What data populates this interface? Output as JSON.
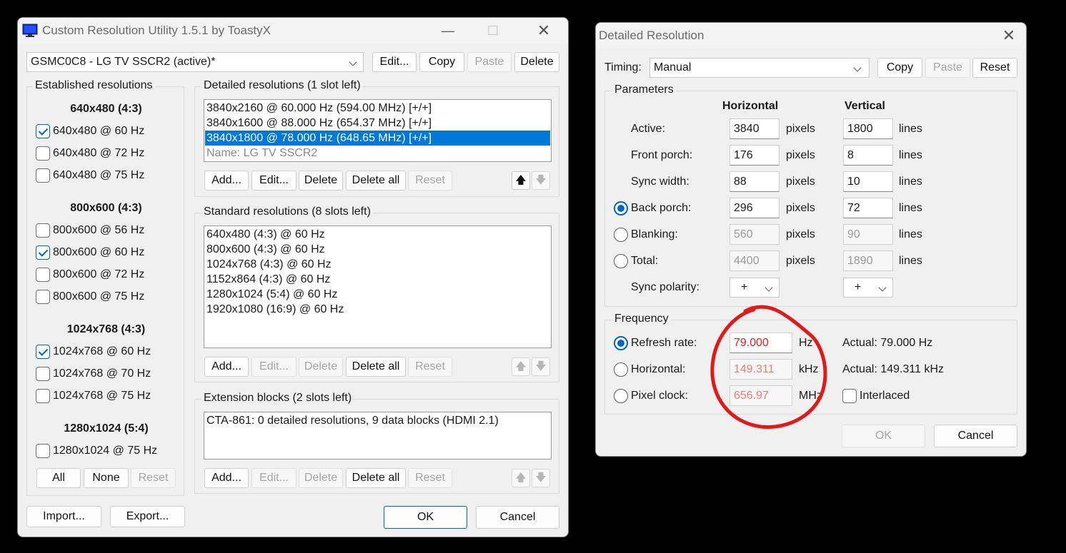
{
  "main": {
    "title": "Custom Resolution Utility 1.5.1 by ToastyX",
    "monitor_select": "GSMC0C8 - LG TV SSCR2 (active)*",
    "top_buttons": {
      "edit": "Edit...",
      "copy": "Copy",
      "paste": "Paste",
      "delete": "Delete"
    },
    "established": {
      "label": "Established resolutions",
      "groups": [
        {
          "header": "640x480 (4:3)",
          "items": [
            {
              "label": "640x480 @ 60 Hz",
              "checked": true
            },
            {
              "label": "640x480 @ 72 Hz",
              "checked": false
            },
            {
              "label": "640x480 @ 75 Hz",
              "checked": false
            }
          ]
        },
        {
          "header": "800x600 (4:3)",
          "items": [
            {
              "label": "800x600 @ 56 Hz",
              "checked": false
            },
            {
              "label": "800x600 @ 60 Hz",
              "checked": true
            },
            {
              "label": "800x600 @ 72 Hz",
              "checked": false
            },
            {
              "label": "800x600 @ 75 Hz",
              "checked": false
            }
          ]
        },
        {
          "header": "1024x768 (4:3)",
          "items": [
            {
              "label": "1024x768 @ 60 Hz",
              "checked": true
            },
            {
              "label": "1024x768 @ 70 Hz",
              "checked": false
            },
            {
              "label": "1024x768 @ 75 Hz",
              "checked": false
            }
          ]
        },
        {
          "header": "1280x1024 (5:4)",
          "items": [
            {
              "label": "1280x1024 @ 75 Hz",
              "checked": false
            }
          ]
        }
      ],
      "buttons": {
        "all": "All",
        "none": "None",
        "reset": "Reset"
      }
    },
    "detailed": {
      "label": "Detailed resolutions (1 slot left)",
      "items": [
        "3840x2160 @ 60.000 Hz (594.00 MHz) [+/+]",
        "3840x1600 @ 88.000 Hz (654.37 MHz) [+/+]",
        "3840x1800 @ 78.000 Hz (648.65 MHz) [+/+]"
      ],
      "name_line": "Name: LG TV SSCR2",
      "buttons": {
        "add": "Add...",
        "edit": "Edit...",
        "delete": "Delete",
        "delete_all": "Delete all",
        "reset": "Reset"
      }
    },
    "standard": {
      "label": "Standard resolutions (8 slots left)",
      "items": [
        "640x480 (4:3) @ 60 Hz",
        "800x600 (4:3) @ 60 Hz",
        "1024x768 (4:3) @ 60 Hz",
        "1152x864 (4:3) @ 60 Hz",
        "1280x1024 (5:4) @ 60 Hz",
        "1920x1080 (16:9) @ 60 Hz"
      ],
      "buttons": {
        "add": "Add...",
        "edit": "Edit...",
        "delete": "Delete",
        "delete_all": "Delete all",
        "reset": "Reset"
      }
    },
    "extension": {
      "label": "Extension blocks (2 slots left)",
      "items": [
        "CTA-861: 0 detailed resolutions, 9 data blocks (HDMI 2.1)"
      ],
      "buttons": {
        "add": "Add...",
        "edit": "Edit...",
        "delete": "Delete",
        "delete_all": "Delete all",
        "reset": "Reset"
      }
    },
    "bottom": {
      "import": "Import...",
      "export": "Export...",
      "ok": "OK",
      "cancel": "Cancel"
    }
  },
  "detail": {
    "title": "Detailed Resolution",
    "timing_label": "Timing:",
    "timing_value": "Manual",
    "buttons": {
      "copy": "Copy",
      "paste": "Paste",
      "reset": "Reset"
    },
    "params": {
      "label": "Parameters",
      "col_h": "Horizontal",
      "col_v": "Vertical",
      "unit_h": "pixels",
      "unit_v": "lines",
      "rows": [
        {
          "label": "Active:",
          "h": "3840",
          "v": "1800"
        },
        {
          "label": "Front porch:",
          "h": "176",
          "v": "8"
        },
        {
          "label": "Sync width:",
          "h": "88",
          "v": "10"
        },
        {
          "label": "Back porch:",
          "h": "296",
          "v": "72"
        },
        {
          "label": "Blanking:",
          "h": "560",
          "v": "90"
        },
        {
          "label": "Total:",
          "h": "4400",
          "v": "1890"
        }
      ],
      "polarity_label": "Sync polarity:",
      "polarity_h": "+",
      "polarity_v": "+"
    },
    "freq": {
      "label": "Frequency",
      "rows": [
        {
          "label": "Refresh rate:",
          "value": "79.000",
          "unit": "Hz",
          "actual": "Actual: 79.000 Hz"
        },
        {
          "label": "Horizontal:",
          "value": "149.311",
          "unit": "kHz",
          "actual": "Actual: 149.311 kHz"
        },
        {
          "label": "Pixel clock:",
          "value": "656.97",
          "unit": "MHz"
        }
      ],
      "interlaced": "Interlaced"
    },
    "ok": "OK",
    "cancel": "Cancel"
  },
  "colors": {
    "accent": "#0067c0",
    "selection": "#0078d7",
    "annotation": "#e01a1a"
  }
}
